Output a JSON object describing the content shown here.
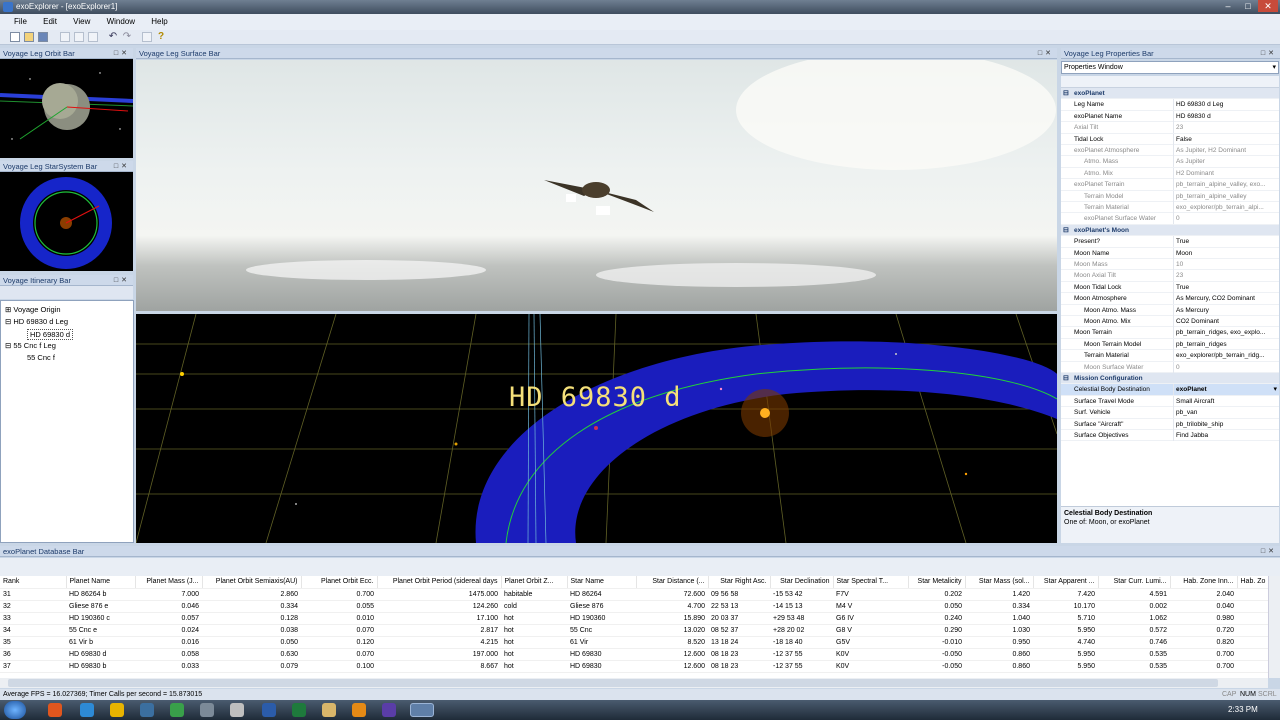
{
  "window": {
    "title": "exoExplorer - [exoExplorer1]"
  },
  "menu": [
    "File",
    "Edit",
    "View",
    "Window",
    "Help"
  ],
  "panels": {
    "orbit": "Voyage Leg Orbit Bar",
    "starsystem": "Voyage Leg StarSystem Bar",
    "itinerary": "Voyage Itinerary Bar",
    "surface": "Voyage Leg Surface Bar",
    "properties": "Voyage Leg Properties Bar",
    "database": "exoPlanet Database Bar"
  },
  "itinerary": {
    "items": [
      {
        "label": "Voyage Origin",
        "level": 0,
        "exp": "+"
      },
      {
        "label": "HD 69830 d Leg",
        "level": 0,
        "exp": "-"
      },
      {
        "label": "HD 69830 d",
        "level": 1,
        "exp": ""
      },
      {
        "label": "55 Cnc f Leg",
        "level": 0,
        "exp": "-"
      },
      {
        "label": "55 Cnc f",
        "level": 1,
        "exp": ""
      }
    ]
  },
  "starview": {
    "label": "HD 69830 d"
  },
  "properties": {
    "dropdown": "Properties Window",
    "rows": [
      {
        "t": "g",
        "n": "exoPlanet"
      },
      {
        "n": "Leg Name",
        "v": "HD 69830 d Leg"
      },
      {
        "n": "exoPlanet Name",
        "v": "HD 69830 d"
      },
      {
        "n": "Axial Tilt",
        "v": "23",
        "gray": true
      },
      {
        "n": "Tidal Lock",
        "v": "False"
      },
      {
        "n": "exoPlanet Atmosphere",
        "v": "As Jupiter, H2 Dominant",
        "gray": true
      },
      {
        "n": "Atmo. Mass",
        "v": "As Jupiter",
        "gray": true,
        "ind": true
      },
      {
        "n": "Atmo. Mix",
        "v": "H2 Dominant",
        "gray": true,
        "ind": true
      },
      {
        "n": "exoPlanet Terrain",
        "v": "pb_terrain_alpine_valley, exo...",
        "gray": true
      },
      {
        "n": "Terrain Model",
        "v": "pb_terrain_alpine_valley",
        "gray": true,
        "ind": true
      },
      {
        "n": "Terrain Material",
        "v": "exo_explorer/pb_terrain_alpi...",
        "gray": true,
        "ind": true
      },
      {
        "n": "exoPlanet Surface Water",
        "v": "0",
        "gray": true,
        "ind": true
      },
      {
        "t": "g",
        "n": "exoPlanet's Moon"
      },
      {
        "n": "Present?",
        "v": "True"
      },
      {
        "n": "Moon Name",
        "v": "Moon"
      },
      {
        "n": "Moon Mass",
        "v": "10",
        "gray": true
      },
      {
        "n": "Moon Axial Tilt",
        "v": "23",
        "gray": true
      },
      {
        "n": "Moon Tidal Lock",
        "v": "True"
      },
      {
        "n": "Moon Atmosphere",
        "v": "As Mercury, CO2 Dominant"
      },
      {
        "n": "Moon Atmo. Mass",
        "v": "As Mercury",
        "ind": true
      },
      {
        "n": "Moon Atmo. Mix",
        "v": "CO2 Dominant",
        "ind": true
      },
      {
        "n": "Moon Terrain",
        "v": "pb_terrain_ridges, exo_explo..."
      },
      {
        "n": "Moon Terrain Model",
        "v": "pb_terrain_ridges",
        "ind": true
      },
      {
        "n": "Terrain Material",
        "v": "exo_explorer/pb_terrain_ridg...",
        "ind": true
      },
      {
        "n": "Moon Surface Water",
        "v": "0",
        "gray": true,
        "ind": true
      },
      {
        "t": "g",
        "n": "Mission Configuration"
      },
      {
        "n": "Celestial Body Destination",
        "v": "exoPlanet",
        "sel": true
      },
      {
        "n": "Surface Travel Mode",
        "v": "Small Aircraft"
      },
      {
        "n": "Surf. Vehicle",
        "v": "pb_van"
      },
      {
        "n": "Surface \"Aircraft\"",
        "v": "pb_trilobite_ship"
      },
      {
        "n": "Surface Objectives",
        "v": "Find Jabba"
      }
    ],
    "help_title": "Celestial Body Destination",
    "help_text": "One of: Moon, or exoPlanet"
  },
  "database": {
    "columns": [
      "Rank",
      "Planet Name",
      "Planet Mass (J...",
      "Planet Orbit Semiaxis(AU)",
      "Planet Orbit Ecc.",
      "Planet Orbit Period (sidereal days",
      "Planet Orbit Z...",
      "Star Name",
      "Star Distance (...",
      "Star Right Asc.",
      "Star Declination",
      "Star Spectral T...",
      "Star Metalicity",
      "Star Mass (sol...",
      "Star Apparent ...",
      "Star Curr. Lumi...",
      "Hab. Zone Inn...",
      "Hab. Zo"
    ],
    "rows": [
      [
        "31",
        "HD 86264 b",
        "7.000",
        "2.860",
        "0.700",
        "1475.000",
        "habitable",
        "HD 86264",
        "72.600",
        "09 56 58",
        "-15 53 42",
        "F7V",
        "0.202",
        "1.420",
        "7.420",
        "4.591",
        "2.040",
        ""
      ],
      [
        "32",
        "Gliese 876 e",
        "0.046",
        "0.334",
        "0.055",
        "124.260",
        "cold",
        "Gliese 876",
        "4.700",
        "22 53 13",
        "-14 15 13",
        "M4 V",
        "0.050",
        "0.334",
        "10.170",
        "0.002",
        "0.040",
        ""
      ],
      [
        "33",
        "HD 190360 c",
        "0.057",
        "0.128",
        "0.010",
        "17.100",
        "hot",
        "HD 190360",
        "15.890",
        "20 03 37",
        "+29 53 48",
        "G6 IV",
        "0.240",
        "1.040",
        "5.710",
        "1.062",
        "0.980",
        ""
      ],
      [
        "34",
        "55 Cnc e",
        "0.024",
        "0.038",
        "0.070",
        "2.817",
        "hot",
        "55 Cnc",
        "13.020",
        "08 52 37",
        "+28 20 02",
        "G8 V",
        "0.290",
        "1.030",
        "5.950",
        "0.572",
        "0.720",
        ""
      ],
      [
        "35",
        "61 Vir b",
        "0.016",
        "0.050",
        "0.120",
        "4.215",
        "hot",
        "61 Vir",
        "8.520",
        "13 18 24",
        "-18 18 40",
        "G5V",
        "-0.010",
        "0.950",
        "4.740",
        "0.746",
        "0.820",
        ""
      ],
      [
        "36",
        "HD 69830 d",
        "0.058",
        "0.630",
        "0.070",
        "197.000",
        "hot",
        "HD 69830",
        "12.600",
        "08 18 23",
        "-12 37 55",
        "K0V",
        "-0.050",
        "0.860",
        "5.950",
        "0.535",
        "0.700",
        ""
      ],
      [
        "37",
        "HD 69830 b",
        "0.033",
        "0.079",
        "0.100",
        "8.667",
        "hot",
        "HD 69830",
        "12.600",
        "08 18 23",
        "-12 37 55",
        "K0V",
        "-0.050",
        "0.860",
        "5.950",
        "0.535",
        "0.700",
        ""
      ]
    ]
  },
  "status": {
    "text": "Average FPS = 16.027369;  Timer Calls per second = 15.873015",
    "caps": "CAP",
    "num": "NUM",
    "scrl": "SCRL"
  },
  "taskbar": {
    "time": "2:33 PM"
  }
}
